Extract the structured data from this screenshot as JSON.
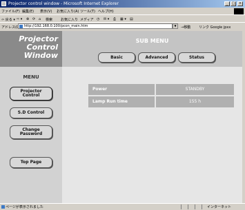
{
  "window": {
    "title": "Projector control window - Microsoft Internet Explorer",
    "min": "_",
    "max": "□",
    "close": "×"
  },
  "menubar": {
    "items": [
      "ファイル(F)",
      "編集(E)",
      "表示(V)",
      "お気に入り(A)",
      "ツール(T)",
      "ヘルプ(H)"
    ]
  },
  "toolbar": {
    "back": "⇦ 戻る ▾",
    "forward": "⇨ ▾",
    "stop": "⊗",
    "refresh": "⟳",
    "home": "⌂",
    "search": "検索",
    "favorites": "お気に入り",
    "media": "メディア",
    "history": "◷",
    "mail": "✉ ▾",
    "print": "⎙",
    "edit": "▦ ▾",
    "discuss": "▤"
  },
  "address": {
    "label": "アドレス(D)",
    "url": "http://192.168.0.100/pcon_main.htm",
    "go": "→移動",
    "links": "リンク",
    "link1": "Google",
    "link2": "jpxx"
  },
  "brand": {
    "line1": "Projector",
    "line2": "Control",
    "line3": "Window"
  },
  "sidebar": {
    "menu_label": "MENU",
    "buttons": [
      {
        "line1": "Projector",
        "line2": "Control"
      },
      {
        "line1": "S.D Control",
        "line2": ""
      },
      {
        "line1": "Change",
        "line2": "Password"
      },
      {
        "line1": "Top Page",
        "line2": ""
      }
    ]
  },
  "submenu": {
    "title": "SUB MENU",
    "tabs": [
      "Basic",
      "Advanced",
      "Status"
    ]
  },
  "status_table": {
    "rows": [
      {
        "label": "Power",
        "value": "STANDBY"
      },
      {
        "label": "Lamp Run time",
        "value": "155 h"
      }
    ]
  },
  "statusbar": {
    "text": "ページが表示されました",
    "zone": "インターネット"
  },
  "colors": {
    "title_gradient_start": "#0a246a",
    "sidebar_bg": "#d2d2d2",
    "header_bg": "#c4c4c4",
    "table_cell": "#b0b0b0",
    "content_bg": "#e6e6e6"
  }
}
